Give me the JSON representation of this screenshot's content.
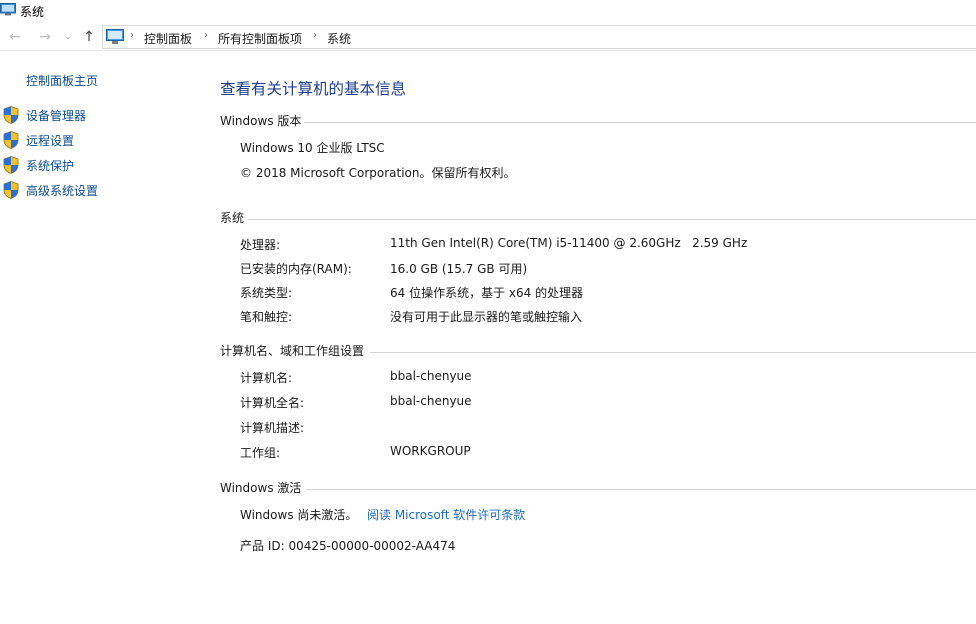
{
  "window": {
    "title": "系统"
  },
  "breadcrumb": {
    "items": [
      "控制面板",
      "所有控制面板项",
      "系统"
    ]
  },
  "sidebar": {
    "home": "控制面板主页",
    "items": [
      {
        "label": "设备管理器",
        "icon": "uac-shield-icon"
      },
      {
        "label": "远程设置",
        "icon": "uac-shield-icon"
      },
      {
        "label": "系统保护",
        "icon": "uac-shield-icon"
      },
      {
        "label": "高级系统设置",
        "icon": "uac-shield-icon"
      }
    ]
  },
  "main": {
    "title": "查看有关计算机的基本信息",
    "edition": {
      "heading": "Windows 版本",
      "name": "Windows 10 企业版 LTSC",
      "copyright": "© 2018 Microsoft Corporation。保留所有权利。"
    },
    "system": {
      "heading": "系统",
      "rows": [
        {
          "label": "处理器:",
          "value": "11th Gen Intel(R) Core(TM) i5-11400 @ 2.60GHz   2.59 GHz"
        },
        {
          "label": "已安装的内存(RAM):",
          "value": "16.0 GB (15.7 GB 可用)"
        },
        {
          "label": "系统类型:",
          "value": "64 位操作系统，基于 x64 的处理器"
        },
        {
          "label": "笔和触控:",
          "value": "没有可用于此显示器的笔或触控输入"
        }
      ]
    },
    "computer": {
      "heading": "计算机名、域和工作组设置",
      "rows": [
        {
          "label": "计算机名:",
          "value": "bbal-chenyue"
        },
        {
          "label": "计算机全名:",
          "value": "bbal-chenyue"
        },
        {
          "label": "计算机描述:",
          "value": ""
        },
        {
          "label": "工作组:",
          "value": "WORKGROUP"
        }
      ]
    },
    "activation": {
      "heading": "Windows 激活",
      "status": "Windows 尚未激活。",
      "license_link": "阅读 Microsoft 软件许可条款",
      "product_id": "产品 ID: 00425-00000-00002-AA474"
    }
  },
  "colors": {
    "link": "#1a6bbd",
    "sidebar_link": "#0b4c8c",
    "title": "#1e3f8e"
  }
}
